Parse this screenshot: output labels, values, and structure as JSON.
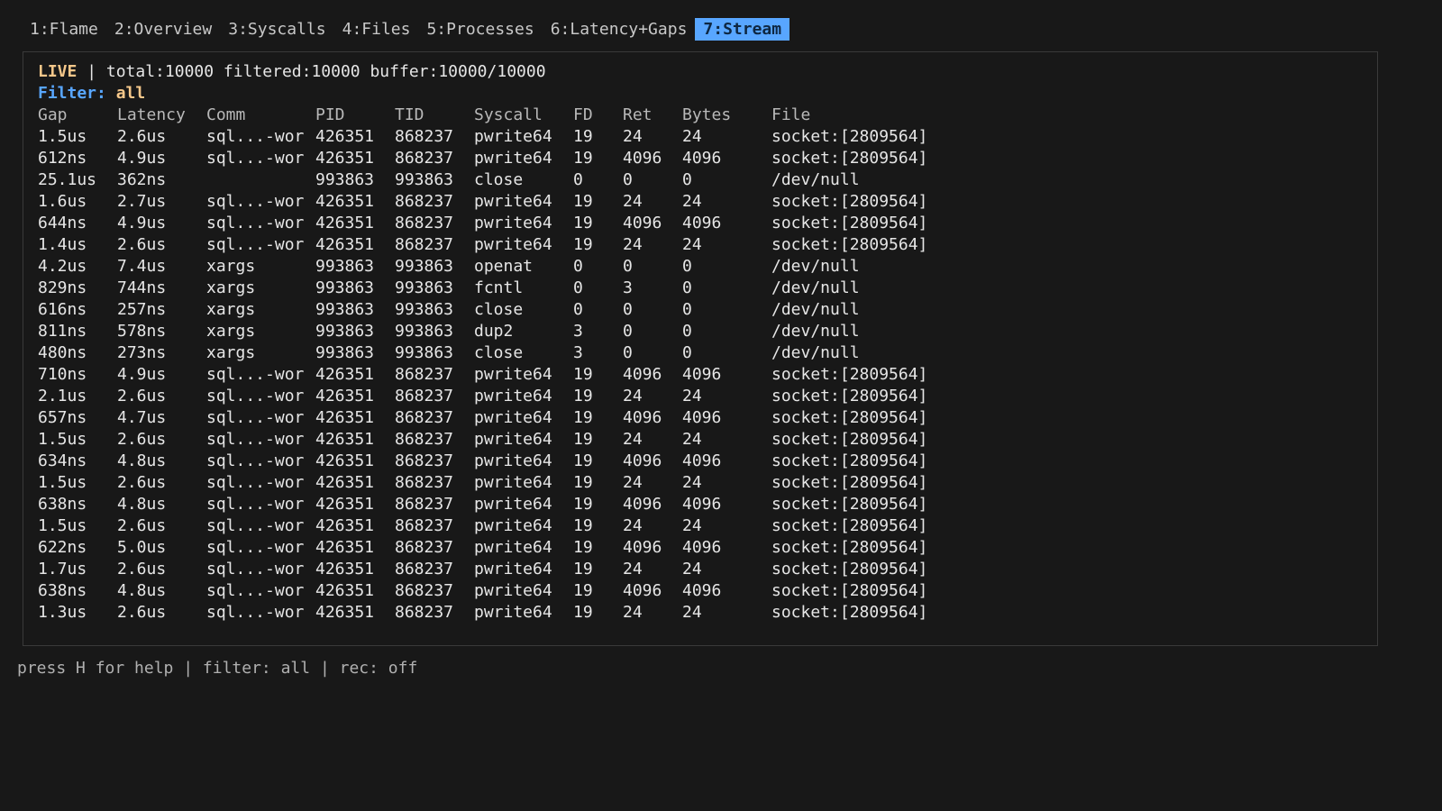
{
  "tabs": [
    {
      "label": "1:Flame",
      "active": false
    },
    {
      "label": "2:Overview",
      "active": false
    },
    {
      "label": "3:Syscalls",
      "active": false
    },
    {
      "label": "4:Files",
      "active": false
    },
    {
      "label": "5:Processes",
      "active": false
    },
    {
      "label": "6:Latency+Gaps",
      "active": false
    },
    {
      "label": "7:Stream",
      "active": true
    }
  ],
  "status": {
    "mode": "LIVE",
    "separator": " | ",
    "stats": "total:10000 filtered:10000 buffer:10000/10000"
  },
  "filter": {
    "label": "Filter:",
    "value": "all"
  },
  "table": {
    "headers": [
      "Gap",
      "Latency",
      "Comm",
      "PID",
      "TID",
      "Syscall",
      "FD",
      "Ret",
      "Bytes",
      "File"
    ],
    "rows": [
      [
        "1.5us",
        "2.6us",
        "sql...-wor",
        "426351",
        "868237",
        "pwrite64",
        "19",
        "24",
        "24",
        "socket:[2809564]"
      ],
      [
        "612ns",
        "4.9us",
        "sql...-wor",
        "426351",
        "868237",
        "pwrite64",
        "19",
        "4096",
        "4096",
        "socket:[2809564]"
      ],
      [
        "25.1us",
        "362ns",
        "",
        "993863",
        "993863",
        "close",
        "0",
        "0",
        "0",
        "/dev/null"
      ],
      [
        "1.6us",
        "2.7us",
        "sql...-wor",
        "426351",
        "868237",
        "pwrite64",
        "19",
        "24",
        "24",
        "socket:[2809564]"
      ],
      [
        "644ns",
        "4.9us",
        "sql...-wor",
        "426351",
        "868237",
        "pwrite64",
        "19",
        "4096",
        "4096",
        "socket:[2809564]"
      ],
      [
        "1.4us",
        "2.6us",
        "sql...-wor",
        "426351",
        "868237",
        "pwrite64",
        "19",
        "24",
        "24",
        "socket:[2809564]"
      ],
      [
        "4.2us",
        "7.4us",
        "xargs",
        "993863",
        "993863",
        "openat",
        "0",
        "0",
        "0",
        "/dev/null"
      ],
      [
        "829ns",
        "744ns",
        "xargs",
        "993863",
        "993863",
        "fcntl",
        "0",
        "3",
        "0",
        "/dev/null"
      ],
      [
        "616ns",
        "257ns",
        "xargs",
        "993863",
        "993863",
        "close",
        "0",
        "0",
        "0",
        "/dev/null"
      ],
      [
        "811ns",
        "578ns",
        "xargs",
        "993863",
        "993863",
        "dup2",
        "3",
        "0",
        "0",
        "/dev/null"
      ],
      [
        "480ns",
        "273ns",
        "xargs",
        "993863",
        "993863",
        "close",
        "3",
        "0",
        "0",
        "/dev/null"
      ],
      [
        "710ns",
        "4.9us",
        "sql...-wor",
        "426351",
        "868237",
        "pwrite64",
        "19",
        "4096",
        "4096",
        "socket:[2809564]"
      ],
      [
        "2.1us",
        "2.6us",
        "sql...-wor",
        "426351",
        "868237",
        "pwrite64",
        "19",
        "24",
        "24",
        "socket:[2809564]"
      ],
      [
        "657ns",
        "4.7us",
        "sql...-wor",
        "426351",
        "868237",
        "pwrite64",
        "19",
        "4096",
        "4096",
        "socket:[2809564]"
      ],
      [
        "1.5us",
        "2.6us",
        "sql...-wor",
        "426351",
        "868237",
        "pwrite64",
        "19",
        "24",
        "24",
        "socket:[2809564]"
      ],
      [
        "634ns",
        "4.8us",
        "sql...-wor",
        "426351",
        "868237",
        "pwrite64",
        "19",
        "4096",
        "4096",
        "socket:[2809564]"
      ],
      [
        "1.5us",
        "2.6us",
        "sql...-wor",
        "426351",
        "868237",
        "pwrite64",
        "19",
        "24",
        "24",
        "socket:[2809564]"
      ],
      [
        "638ns",
        "4.8us",
        "sql...-wor",
        "426351",
        "868237",
        "pwrite64",
        "19",
        "4096",
        "4096",
        "socket:[2809564]"
      ],
      [
        "1.5us",
        "2.6us",
        "sql...-wor",
        "426351",
        "868237",
        "pwrite64",
        "19",
        "24",
        "24",
        "socket:[2809564]"
      ],
      [
        "622ns",
        "5.0us",
        "sql...-wor",
        "426351",
        "868237",
        "pwrite64",
        "19",
        "4096",
        "4096",
        "socket:[2809564]"
      ],
      [
        "1.7us",
        "2.6us",
        "sql...-wor",
        "426351",
        "868237",
        "pwrite64",
        "19",
        "24",
        "24",
        "socket:[2809564]"
      ],
      [
        "638ns",
        "4.8us",
        "sql...-wor",
        "426351",
        "868237",
        "pwrite64",
        "19",
        "4096",
        "4096",
        "socket:[2809564]"
      ],
      [
        "1.3us",
        "2.6us",
        "sql...-wor",
        "426351",
        "868237",
        "pwrite64",
        "19",
        "24",
        "24",
        "socket:[2809564]"
      ]
    ]
  },
  "footer": "press H for help | filter: all | rec: off",
  "colors": {
    "background": "#181818",
    "active_tab": "#58a6ff",
    "live": "#f5c78a",
    "filter_label": "#58a6ff"
  }
}
